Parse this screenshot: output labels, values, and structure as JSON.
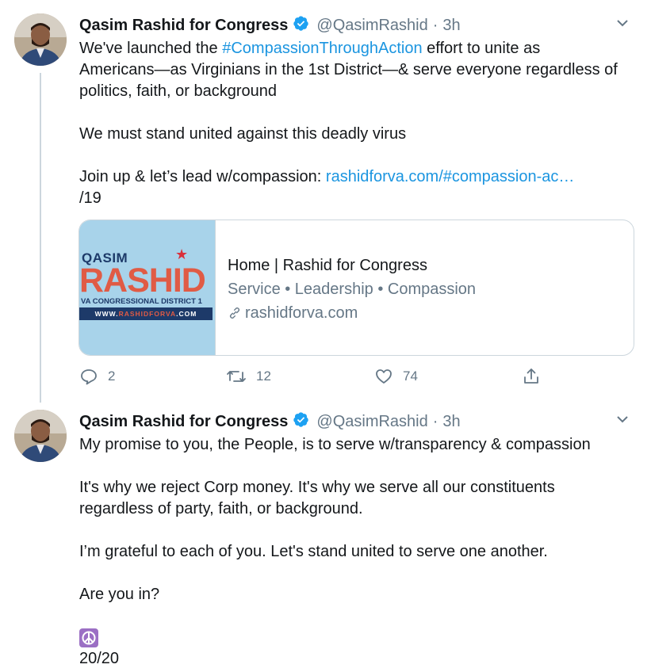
{
  "tweets": [
    {
      "author_name": "Qasim Rashid for Congress",
      "handle": "@QasimRashid",
      "separator": "·",
      "time": "3h",
      "lines": {
        "l1a": "We've launched the ",
        "l1_hashtag": "#CompassionThroughAction",
        "l1b": " effort to unite as",
        "l2": "Americans—as Virginians in the 1st District—& serve everyone regardless of",
        "l3": "politics, faith, or background",
        "l4": "We must stand united against this deadly virus",
        "l5a": "Join up & let’s lead w/compassion: ",
        "l5_link": "rashidforva.com/#compassion-ac…",
        "l6": "/19"
      },
      "card": {
        "image_text": {
          "first": "QASIM",
          "last": "RASHID",
          "district": "VA CONGRESSIONAL DISTRICT 1",
          "url_prefix": "WWW.",
          "url_mid": "RASHIDFORVA",
          "url_suffix": ".COM"
        },
        "title": "Home | Rashid for Congress",
        "description": "Service • Leadership • Compassion",
        "domain": "rashidforva.com"
      },
      "actions": {
        "replies": "2",
        "retweets": "12",
        "likes": "74"
      }
    },
    {
      "author_name": "Qasim Rashid for Congress",
      "handle": "@QasimRashid",
      "separator": "·",
      "time": "3h",
      "lines": {
        "l1": "My promise to you, the People, is to serve w/transparency & compassion",
        "l2": "It's why we reject Corp money. It's why we serve all our constituents",
        "l3": "regardless of party, faith, or background.",
        "l4": "I’m grateful to each of you. Let's stand united to serve one another.",
        "l5": "Are you in?",
        "l6": "20/20"
      },
      "emoji": "peace-symbol"
    }
  ],
  "colors": {
    "link": "#1b95e0",
    "secondary": "#657786",
    "verified": "#1da1f2",
    "border": "#ccd6dd"
  }
}
